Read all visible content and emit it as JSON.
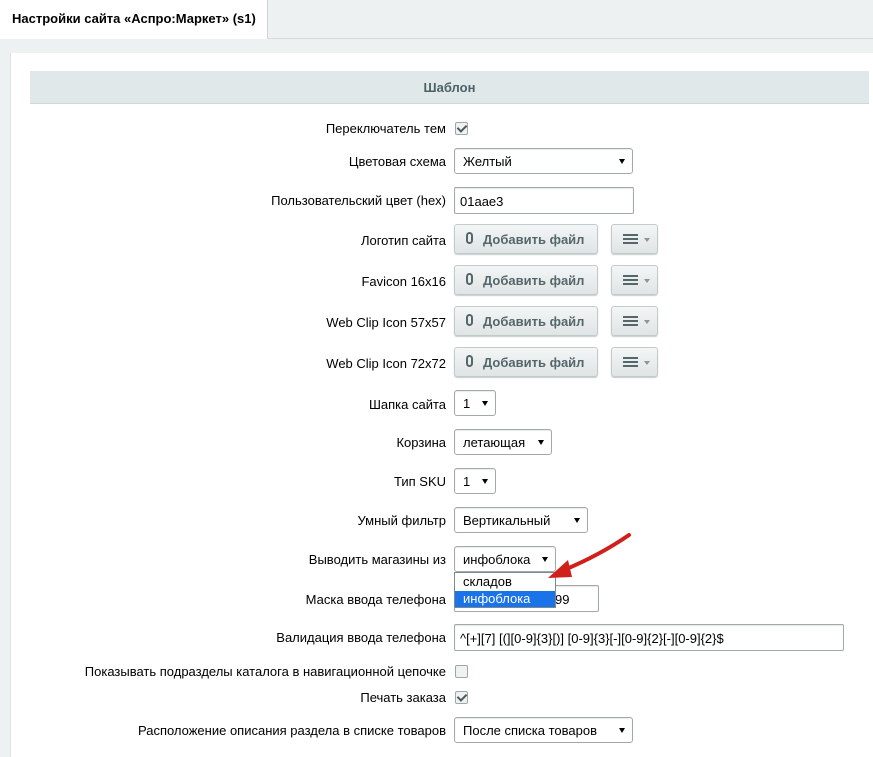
{
  "tab": {
    "title": "Настройки сайта «Аспро:Маркет» (s1)"
  },
  "section": {
    "title": "Шаблон"
  },
  "fields": {
    "theme_switcher": {
      "label": "Переключатель тем",
      "checked": true
    },
    "color_scheme": {
      "label": "Цветовая схема",
      "value": "Желтый"
    },
    "custom_color": {
      "label": "Пользовательский цвет (hex)",
      "value": "01aae3"
    },
    "logo": {
      "label": "Логотип сайта",
      "button": "Добавить файл"
    },
    "favicon": {
      "label": "Favicon 16x16",
      "button": "Добавить файл"
    },
    "webclip57": {
      "label": "Web Clip Icon 57x57",
      "button": "Добавить файл"
    },
    "webclip72": {
      "label": "Web Clip Icon 72x72",
      "button": "Добавить файл"
    },
    "header": {
      "label": "Шапка сайта",
      "value": "1"
    },
    "basket": {
      "label": "Корзина",
      "value": "летающая"
    },
    "sku_type": {
      "label": "Тип SKU",
      "value": "1"
    },
    "smart_filter": {
      "label": "Умный фильтр",
      "value": "Вертикальный"
    },
    "stores_source": {
      "label": "Выводить магазины из",
      "value": "инфоблока",
      "options": [
        "складов",
        "инфоблока"
      ]
    },
    "phone_mask": {
      "label": "Маска ввода телефона",
      "value": "99"
    },
    "phone_validation": {
      "label": "Валидация ввода телефона",
      "value": "^[+][7] [(][0-9]{3}[)] [0-9]{3}[-][0-9]{2}[-][0-9]{2}$"
    },
    "show_subsections": {
      "label": "Показывать подразделы каталога в навигационной цепочке",
      "checked": false
    },
    "print_order": {
      "label": "Печать заказа",
      "checked": true
    },
    "section_desc_position": {
      "label": "Расположение описания раздела в списке товаров",
      "value": "После списка товаров"
    }
  },
  "icons": {
    "file_button": "paperclip-icon",
    "menu_button": "hamburger-icon",
    "annotation": "red-arrow"
  },
  "colors": {
    "accent_selection": "#1a73e8",
    "section_header_bg": "#e0e8ea",
    "arrow": "#d0201b"
  }
}
